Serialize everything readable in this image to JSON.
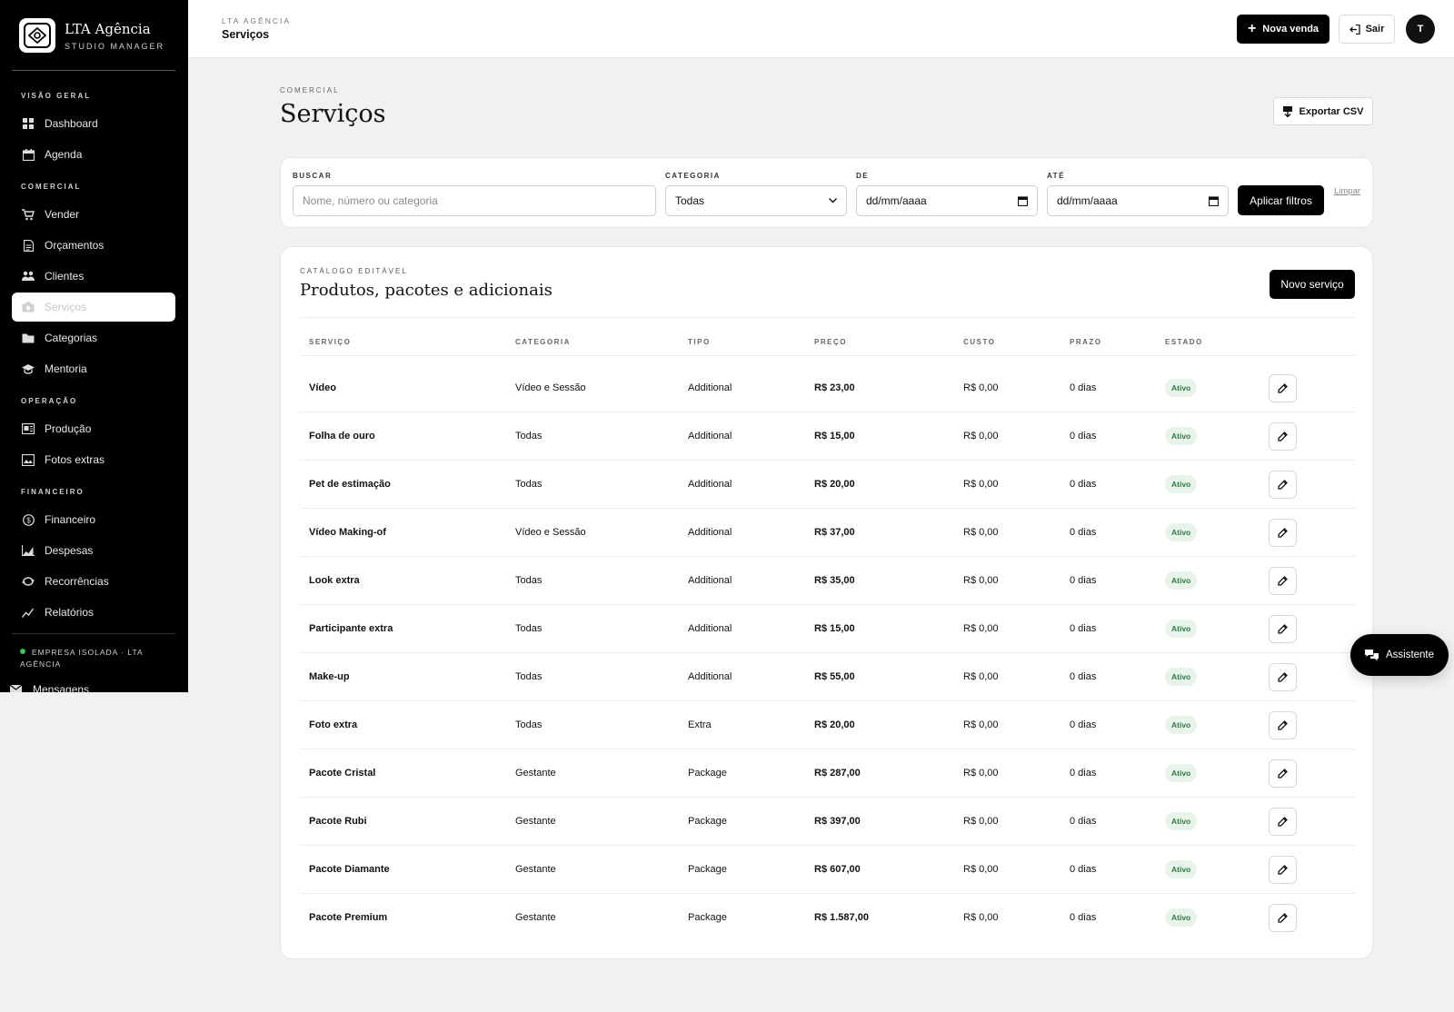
{
  "brand": {
    "name": "LTA Agência",
    "subtitle": "STUDIO MANAGER"
  },
  "sidebar": {
    "sections": [
      {
        "title": "VISÃO GERAL",
        "items": [
          {
            "label": "Dashboard",
            "icon": "dashboard-icon"
          },
          {
            "label": "Agenda",
            "icon": "calendar-icon"
          }
        ]
      },
      {
        "title": "COMERCIAL",
        "items": [
          {
            "label": "Vender",
            "icon": "cart-icon"
          },
          {
            "label": "Orçamentos",
            "icon": "document-icon"
          },
          {
            "label": "Clientes",
            "icon": "users-icon"
          },
          {
            "label": "Serviços",
            "icon": "camera-icon",
            "active": true
          },
          {
            "label": "Categorias",
            "icon": "folder-icon"
          },
          {
            "label": "Mentoria",
            "icon": "graduation-cap-icon"
          }
        ]
      },
      {
        "title": "OPERAÇÃO",
        "items": [
          {
            "label": "Produção",
            "icon": "production-icon"
          },
          {
            "label": "Fotos extras",
            "icon": "photos-icon"
          }
        ]
      },
      {
        "title": "FINANCEIRO",
        "items": [
          {
            "label": "Financeiro",
            "icon": "dollar-icon"
          },
          {
            "label": "Despesas",
            "icon": "area-chart-icon"
          },
          {
            "label": "Recorrências",
            "icon": "repeat-icon"
          },
          {
            "label": "Relatórios",
            "icon": "line-chart-icon"
          }
        ]
      }
    ],
    "footer": {
      "company": "EMPRESA ISOLADA · LTA AGÊNCIA",
      "status_color": "#3fbf5f",
      "messages_label": "Mensagens"
    }
  },
  "topbar": {
    "org": "LTA AGÊNCIA",
    "page": "Serviços",
    "new_sale_label": "Nova venda",
    "logout_label": "Sair",
    "avatar_initial": "T"
  },
  "header": {
    "eyebrow": "COMERCIAL",
    "title": "Serviços",
    "export_label": "Exportar CSV"
  },
  "filters": {
    "search_label": "BUSCAR",
    "search_placeholder": "Nome, número ou categoria",
    "category_label": "CATEGORIA",
    "category_value": "Todas",
    "from_label": "DE",
    "from_placeholder": "dd/mm/aaaa",
    "to_label": "ATÉ",
    "to_placeholder": "dd/mm/aaaa",
    "apply_label": "Aplicar filtros",
    "clear_label": "Limpar"
  },
  "catalog": {
    "eyebrow": "CATÁLOGO EDITÁVEL",
    "title": "Produtos, pacotes e adicionais",
    "new_label": "Novo serviço",
    "columns": [
      "SERVIÇO",
      "CATEGORIA",
      "TIPO",
      "PREÇO",
      "CUSTO",
      "PRAZO",
      "ESTADO"
    ],
    "rows": [
      {
        "name": "Vídeo",
        "category": "Vídeo e Sessão",
        "type": "Additional",
        "price": "R$ 23,00",
        "cost": "R$ 0,00",
        "term": "0 dias",
        "status": "Ativo"
      },
      {
        "name": "Folha de ouro",
        "category": "Todas",
        "type": "Additional",
        "price": "R$ 15,00",
        "cost": "R$ 0,00",
        "term": "0 dias",
        "status": "Ativo"
      },
      {
        "name": "Pet de estimação",
        "category": "Todas",
        "type": "Additional",
        "price": "R$ 20,00",
        "cost": "R$ 0,00",
        "term": "0 dias",
        "status": "Ativo"
      },
      {
        "name": "Vídeo Making-of",
        "category": "Vídeo e Sessão",
        "type": "Additional",
        "price": "R$ 37,00",
        "cost": "R$ 0,00",
        "term": "0 dias",
        "status": "Ativo"
      },
      {
        "name": "Look extra",
        "category": "Todas",
        "type": "Additional",
        "price": "R$ 35,00",
        "cost": "R$ 0,00",
        "term": "0 dias",
        "status": "Ativo"
      },
      {
        "name": "Participante extra",
        "category": "Todas",
        "type": "Additional",
        "price": "R$ 15,00",
        "cost": "R$ 0,00",
        "term": "0 dias",
        "status": "Ativo"
      },
      {
        "name": "Make-up",
        "category": "Todas",
        "type": "Additional",
        "price": "R$ 55,00",
        "cost": "R$ 0,00",
        "term": "0 dias",
        "status": "Ativo"
      },
      {
        "name": "Foto extra",
        "category": "Todas",
        "type": "Extra",
        "price": "R$ 20,00",
        "cost": "R$ 0,00",
        "term": "0 dias",
        "status": "Ativo"
      },
      {
        "name": "Pacote Cristal",
        "category": "Gestante",
        "type": "Package",
        "price": "R$ 287,00",
        "cost": "R$ 0,00",
        "term": "0 dias",
        "status": "Ativo"
      },
      {
        "name": "Pacote Rubi",
        "category": "Gestante",
        "type": "Package",
        "price": "R$ 397,00",
        "cost": "R$ 0,00",
        "term": "0 dias",
        "status": "Ativo"
      },
      {
        "name": "Pacote Diamante",
        "category": "Gestante",
        "type": "Package",
        "price": "R$ 607,00",
        "cost": "R$ 0,00",
        "term": "0 dias",
        "status": "Ativo"
      },
      {
        "name": "Pacote Premium",
        "category": "Gestante",
        "type": "Package",
        "price": "R$ 1.587,00",
        "cost": "R$ 0,00",
        "term": "0 dias",
        "status": "Ativo"
      }
    ]
  },
  "assistant": {
    "label": "Assistente"
  },
  "colors": {
    "sidebar_bg": "#000000",
    "page_bg": "#f1f1ef",
    "status_active_bg": "#e8f3ea",
    "status_active_text": "#2f7a45"
  }
}
